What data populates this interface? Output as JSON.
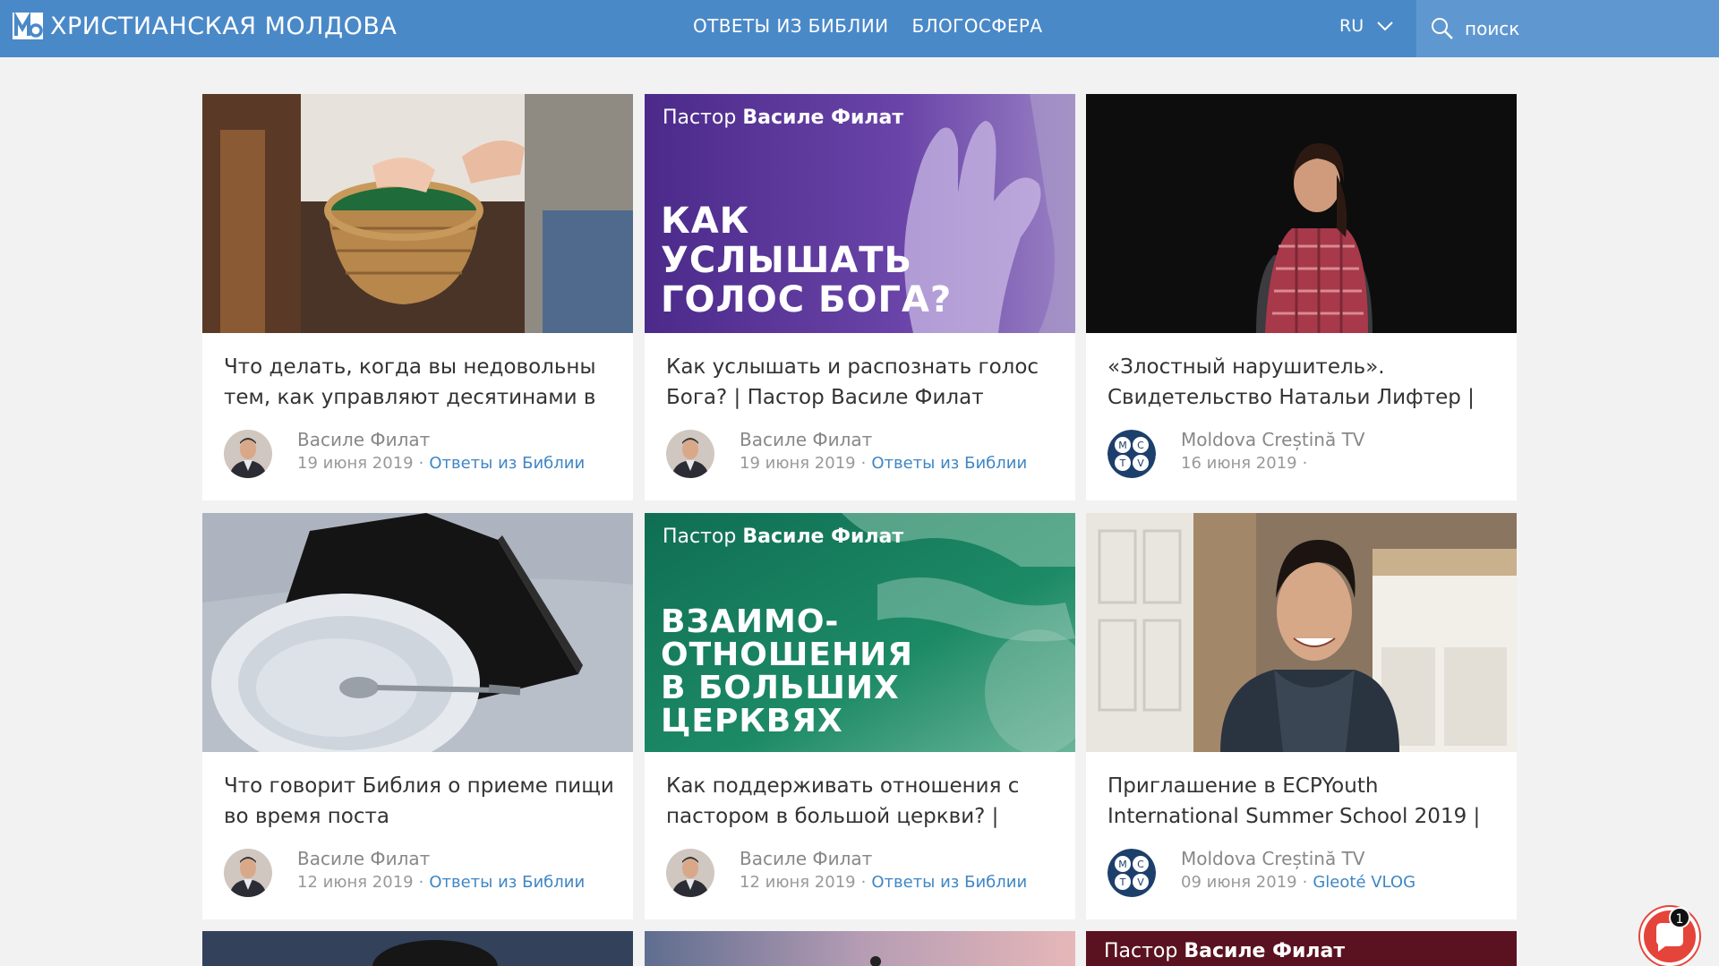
{
  "header": {
    "logo_text": "ХРИСТИАНСКАЯ МОЛДОВА",
    "nav": [
      "ОТВЕТЫ ИЗ БИБЛИИ",
      "БЛОГОСФЕРА"
    ],
    "lang": "RU",
    "search_placeholder": "поиск",
    "colors": {
      "bar": "#4a89c8",
      "search_bg": "#5f98d0"
    }
  },
  "cards": [
    {
      "title": "Что делать, когда вы недовольны тем, как управляют десятинами в",
      "author": "Василе Филат",
      "date": "19 июня 2019",
      "category": "Ответы из Библии",
      "avatar": "pastor-avatar",
      "thumb": "offering-basket-photo"
    },
    {
      "title": "Как услышать и распознать голос Бога? | Пастор Василе Филат",
      "author": "Василе Филат",
      "date": "19 июня 2019",
      "category": "Ответы из Библии",
      "avatar": "pastor-avatar",
      "thumb": "purple-banner",
      "banner": {
        "caption_prefix": "Пастор",
        "caption_name": "Василе Филат",
        "big": "КАК\nУСЛЫШАТЬ\nГОЛОС БОГА?"
      }
    },
    {
      "title": "«Злостный нарушитель». Свидетельство Натальи Лифтер |",
      "author": "Moldova Creștină TV",
      "date": "16 июня 2019",
      "category": "",
      "avatar": "mctv-logo",
      "thumb": "woman-portrait-photo"
    },
    {
      "title": "Что говорит Библия о приеме пищи во время поста",
      "author": "Василе Филат",
      "date": "12 июня 2019",
      "category": "Ответы из Библии",
      "avatar": "pastor-avatar",
      "thumb": "bowl-bible-photo"
    },
    {
      "title": "Как поддерживать отношения с пастором в большой церкви? |",
      "author": "Василе Филат",
      "date": "12 июня 2019",
      "category": "Ответы из Библии",
      "avatar": "pastor-avatar",
      "thumb": "green-banner",
      "banner": {
        "caption_prefix": "Пастор",
        "caption_name": "Василе Филат",
        "big": "ВЗАИМО-\nОТНОШЕНИЯ\nВ БОЛЬШИХ\nЦЕРКВЯХ"
      }
    },
    {
      "title": "Приглашение в ECPYouth International Summer School 2019 |",
      "author": "Moldova Creștină TV",
      "date": "09 июня 2019",
      "category": "Gleoté VLOG",
      "avatar": "mctv-logo",
      "thumb": "young-man-vlog-photo"
    }
  ],
  "partial_row": {
    "third_caption_prefix": "Пастор",
    "third_caption_name": "Василе Филат"
  },
  "chat": {
    "badge": "1"
  },
  "mctv_letters": [
    "M",
    "C",
    "T",
    "V"
  ]
}
